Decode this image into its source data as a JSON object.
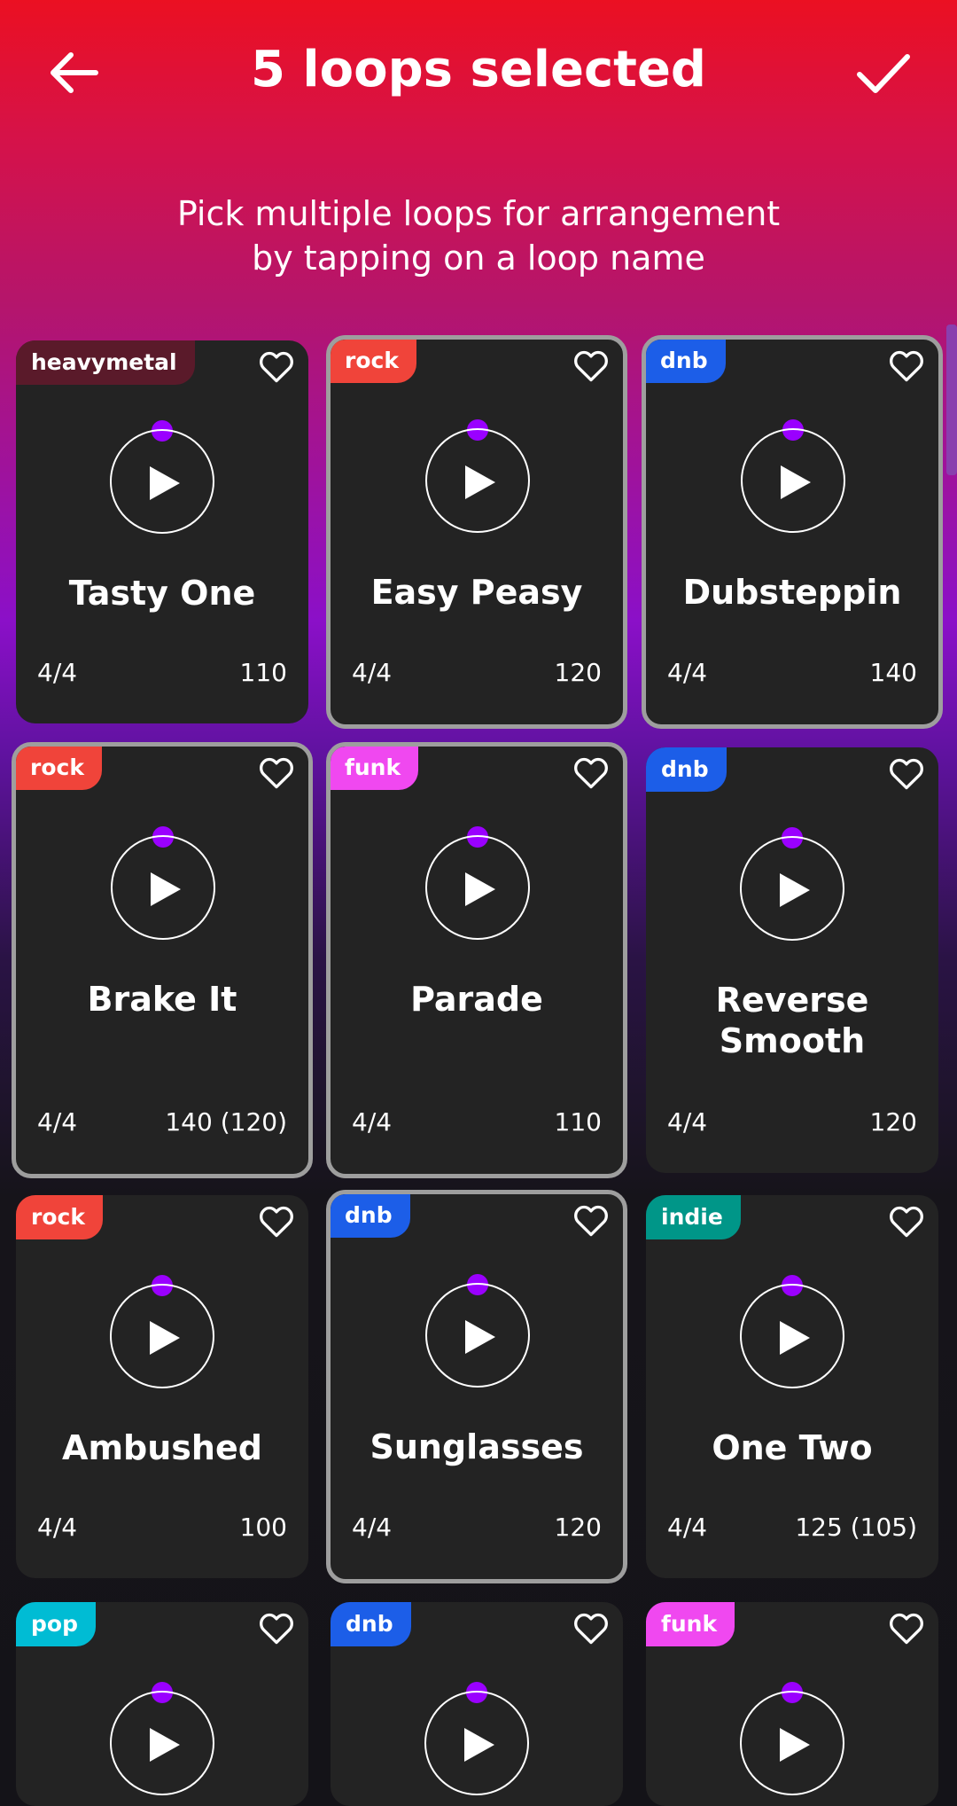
{
  "header": {
    "title": "5 loops selected",
    "subtitle_line1": "Pick multiple loops for arrangement",
    "subtitle_line2": "by tapping on a loop name",
    "back_icon": "arrow-left-icon",
    "confirm_icon": "check-icon"
  },
  "genre_colors": {
    "heavymetal": "#5a1a2a",
    "rock": "#f0443a",
    "dnb": "#1c5ee8",
    "funk": "#f048f0",
    "indie": "#009688",
    "pop": "#00bcd4"
  },
  "accent_color": "#9a00ff",
  "loops": [
    {
      "genre": "heavymetal",
      "name": "Tasty One",
      "meter": "4/4",
      "bpm": "110",
      "selected": false
    },
    {
      "genre": "rock",
      "name": "Easy Peasy",
      "meter": "4/4",
      "bpm": "120",
      "selected": true
    },
    {
      "genre": "dnb",
      "name": "Dubsteppin",
      "meter": "4/4",
      "bpm": "140",
      "selected": true
    },
    {
      "genre": "rock",
      "name": "Brake It",
      "meter": "4/4",
      "bpm": "140 (120)",
      "selected": true
    },
    {
      "genre": "funk",
      "name": "Parade",
      "meter": "4/4",
      "bpm": "110",
      "selected": true
    },
    {
      "genre": "dnb",
      "name": "Reverse Smooth",
      "meter": "4/4",
      "bpm": "120",
      "selected": false
    },
    {
      "genre": "rock",
      "name": "Ambushed",
      "meter": "4/4",
      "bpm": "100",
      "selected": false
    },
    {
      "genre": "dnb",
      "name": "Sunglasses",
      "meter": "4/4",
      "bpm": "120",
      "selected": true
    },
    {
      "genre": "indie",
      "name": "One Two",
      "meter": "4/4",
      "bpm": "125 (105)",
      "selected": false
    },
    {
      "genre": "pop",
      "name": "",
      "meter": "",
      "bpm": "",
      "selected": false
    },
    {
      "genre": "dnb",
      "name": "",
      "meter": "",
      "bpm": "",
      "selected": false
    },
    {
      "genre": "funk",
      "name": "",
      "meter": "",
      "bpm": "",
      "selected": false
    }
  ]
}
